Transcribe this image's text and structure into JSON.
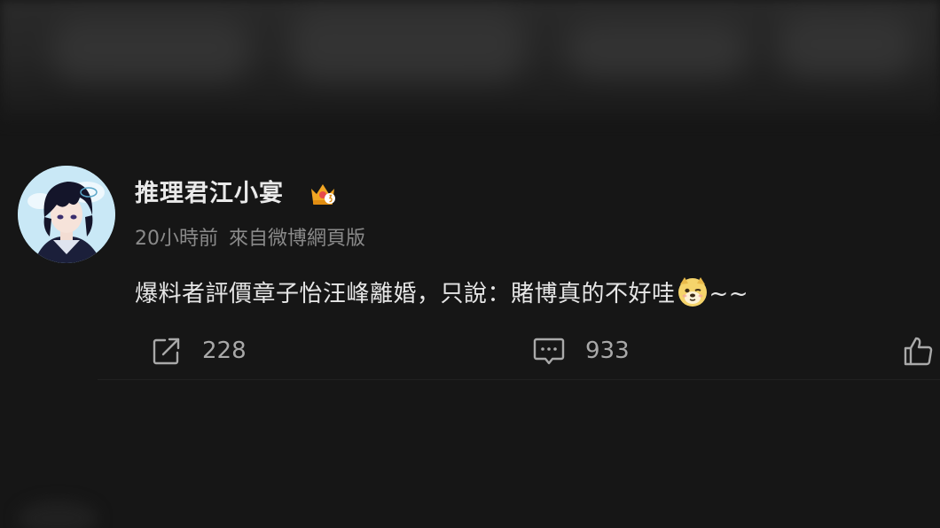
{
  "post": {
    "author": "推理君江小宴",
    "badge_icon": "crown-badge-icon",
    "time": "20小時前",
    "source": "來自微博網頁版",
    "text_before_emoji": "爆料者評價章子怡汪峰離婚，只說：賭博真的不好哇",
    "emoji": "doge-emoji",
    "text_after_emoji": "~~"
  },
  "actions": {
    "repost": {
      "icon": "repost-icon",
      "count": "228"
    },
    "comment": {
      "icon": "comment-icon",
      "count": "933"
    },
    "like": {
      "icon": "thumbs-up-icon"
    }
  },
  "colors": {
    "background": "#161616",
    "author": "#e9e9e9",
    "meta": "#8a8a8a",
    "text": "#e6e6e6",
    "action": "#a9a9a9",
    "badge": "#f2a623"
  }
}
